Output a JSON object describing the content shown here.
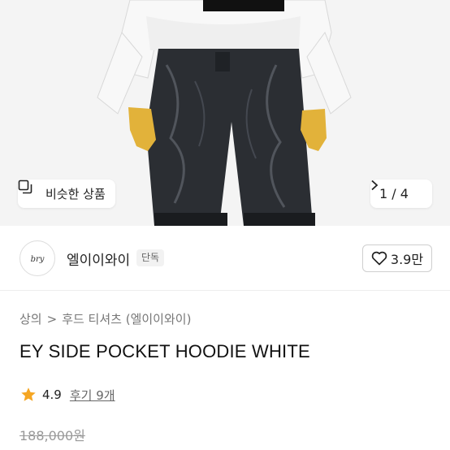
{
  "gallery": {
    "similar_label": "비슷한 상품",
    "current_page": "1",
    "page_separator": "/",
    "total_pages": "4",
    "icon_similar": "similar-products-icon",
    "icon_next": "chevron-right-icon"
  },
  "shop": {
    "logo_text": "bry",
    "name": "엘이이와이",
    "badge": "단독",
    "likes": "3.9만",
    "icon_like": "heart-icon"
  },
  "breadcrumb": {
    "items": [
      "상의",
      "후드 티셔츠 (엘이이와이)"
    ],
    "separator": ">"
  },
  "product": {
    "title": "EY SIDE POCKET HOODIE WHITE",
    "rating": "4.9",
    "reviews_label": "후기 9개",
    "original_price": "188,000원"
  },
  "colors": {
    "star": "#f5a623",
    "background_hero": "#f3f3f3"
  }
}
